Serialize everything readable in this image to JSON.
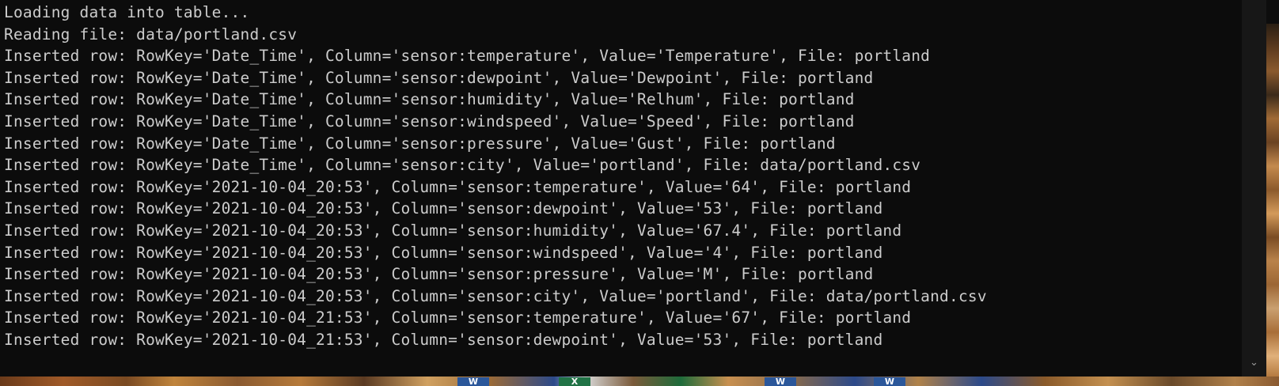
{
  "console": {
    "lines": [
      "Loading data into table...",
      "Reading file: data/portland.csv",
      "Inserted row: RowKey='Date_Time', Column='sensor:temperature', Value='Temperature', File: portland",
      "Inserted row: RowKey='Date_Time', Column='sensor:dewpoint', Value='Dewpoint', File: portland",
      "Inserted row: RowKey='Date_Time', Column='sensor:humidity', Value='Relhum', File: portland",
      "Inserted row: RowKey='Date_Time', Column='sensor:windspeed', Value='Speed', File: portland",
      "Inserted row: RowKey='Date_Time', Column='sensor:pressure', Value='Gust', File: portland",
      "Inserted row: RowKey='Date_Time', Column='sensor:city', Value='portland', File: data/portland.csv",
      "Inserted row: RowKey='2021-10-04_20:53', Column='sensor:temperature', Value='64', File: portland",
      "Inserted row: RowKey='2021-10-04_20:53', Column='sensor:dewpoint', Value='53', File: portland",
      "Inserted row: RowKey='2021-10-04_20:53', Column='sensor:humidity', Value='67.4', File: portland",
      "Inserted row: RowKey='2021-10-04_20:53', Column='sensor:windspeed', Value='4', File: portland",
      "Inserted row: RowKey='2021-10-04_20:53', Column='sensor:pressure', Value='M', File: portland",
      "Inserted row: RowKey='2021-10-04_20:53', Column='sensor:city', Value='portland', File: data/portland.csv",
      "Inserted row: RowKey='2021-10-04_21:53', Column='sensor:temperature', Value='67', File: portland",
      "Inserted row: RowKey='2021-10-04_21:53', Column='sensor:dewpoint', Value='53', File: portland"
    ]
  },
  "scrollbar": {
    "down_arrow": "⌄"
  },
  "taskbar": {
    "icons": [
      {
        "name": "word-icon",
        "glyph": "W",
        "kind": "word"
      },
      {
        "name": "excel-icon",
        "glyph": "X",
        "kind": "excel"
      },
      {
        "name": "word-icon",
        "glyph": "W",
        "kind": "word"
      },
      {
        "name": "word-icon",
        "glyph": "W",
        "kind": "word"
      }
    ]
  },
  "colors": {
    "console_background": "#0c0c0c",
    "console_text": "#cccccc",
    "scrollbar_track": "#171717"
  }
}
